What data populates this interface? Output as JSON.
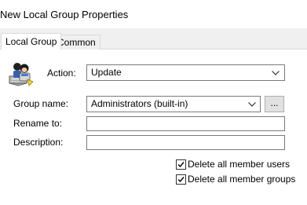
{
  "window": {
    "title": "New Local Group Properties",
    "close_icon": "close-icon"
  },
  "tabs": [
    {
      "label": "Local Group",
      "active": true
    },
    {
      "label": "Common",
      "active": false
    }
  ],
  "form": {
    "icon": "local-group-icon",
    "action": {
      "label": "Action:",
      "value": "Update",
      "dropdown_icon": "chevron-down-icon"
    },
    "group_name": {
      "label": "Group name:",
      "value": "Administrators (built-in)",
      "dropdown_icon": "chevron-down-icon",
      "browse_label": "..."
    },
    "rename_to": {
      "label": "Rename to:",
      "value": ""
    },
    "description": {
      "label": "Description:",
      "value": ""
    },
    "checkboxes": [
      {
        "label": "Delete all member users",
        "checked": true
      },
      {
        "label": "Delete all member groups",
        "checked": true
      }
    ]
  },
  "colors": {
    "dialog_bg": "#f0f0f0",
    "panel_bg": "#ffffff",
    "border": "#7a7a7a",
    "accent": "#0078d7"
  }
}
